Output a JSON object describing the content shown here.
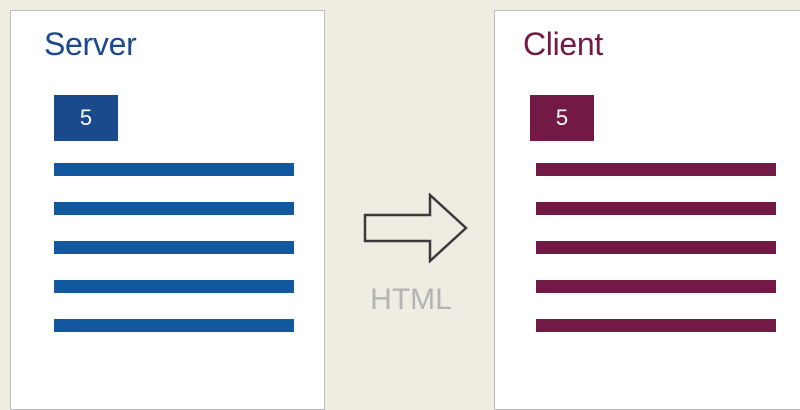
{
  "colors": {
    "background": "#efece2",
    "server_accent": "#1a4a8c",
    "server_lines": "#11589f",
    "client_accent": "#721a45",
    "connector_label": "#b3b3b3",
    "arrow_stroke": "#3a3a3a"
  },
  "server": {
    "title": "Server",
    "badge_value": "5",
    "line_count": 5
  },
  "client": {
    "title": "Client",
    "badge_value": "5",
    "line_count": 5
  },
  "connector": {
    "label": "HTML",
    "icon": "right-arrow-icon"
  }
}
